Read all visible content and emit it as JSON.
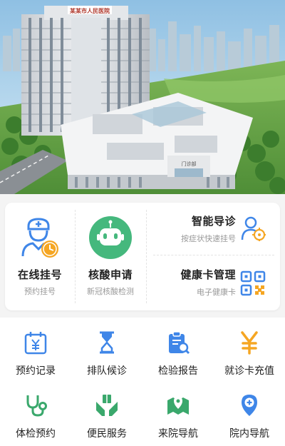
{
  "hero": {
    "building_sign_text": "某某市人民医院",
    "gate_text": "门诊部"
  },
  "main_services": {
    "online_register": {
      "title": "在线挂号",
      "subtitle": "预约挂号"
    },
    "nucleic_test": {
      "title": "核酸申请",
      "subtitle": "新冠核酸检测"
    },
    "smart_guide": {
      "title": "智能导诊",
      "subtitle": "按症状快速挂号"
    },
    "health_card": {
      "title": "健康卡管理",
      "subtitle": "电子健康卡"
    }
  },
  "grid": [
    {
      "label": "预约记录",
      "icon": "calendar-yuan-icon"
    },
    {
      "label": "排队候诊",
      "icon": "hourglass-icon"
    },
    {
      "label": "检验报告",
      "icon": "clipboard-search-icon"
    },
    {
      "label": "就诊卡充值",
      "icon": "yuan-icon"
    },
    {
      "label": "体检预约",
      "icon": "stethoscope-icon"
    },
    {
      "label": "便民服务",
      "icon": "hands-gift-icon"
    },
    {
      "label": "来院导航",
      "icon": "map-pin-icon"
    },
    {
      "label": "院内导航",
      "icon": "location-plus-icon"
    }
  ],
  "colors": {
    "primary_blue": "#3f86e8",
    "robot_green": "#45b87d",
    "accent_orange": "#f5a623",
    "grid_green": "#3aa86c"
  }
}
